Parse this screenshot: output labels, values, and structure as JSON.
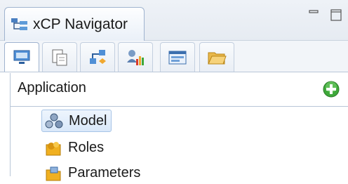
{
  "view": {
    "title": "xCP Navigator",
    "icon": "navigator-icon",
    "window_controls": [
      "minimize-icon",
      "maximize-icon"
    ]
  },
  "toolbar": {
    "tabs": [
      {
        "icon": "application-view-icon",
        "active": true
      },
      {
        "icon": "documents-view-icon",
        "active": false
      },
      {
        "icon": "process-view-icon",
        "active": false
      },
      {
        "icon": "user-chart-icon",
        "active": false
      },
      {
        "icon": "form-view-icon",
        "active": false
      },
      {
        "icon": "folder-view-icon",
        "active": false
      }
    ]
  },
  "section": {
    "title": "Application",
    "add_icon": "add-icon"
  },
  "tree": {
    "items": [
      {
        "label": "Model",
        "icon": "model-icon",
        "selected": true
      },
      {
        "label": "Roles",
        "icon": "roles-icon",
        "selected": false
      },
      {
        "label": "Parameters",
        "icon": "parameters-icon",
        "selected": false
      }
    ]
  },
  "colors": {
    "tab_border": "#9fb3cf",
    "selection_fill": "#d9e8f9",
    "selection_border": "#a7c4e6",
    "add_green": "#3ea83a"
  }
}
